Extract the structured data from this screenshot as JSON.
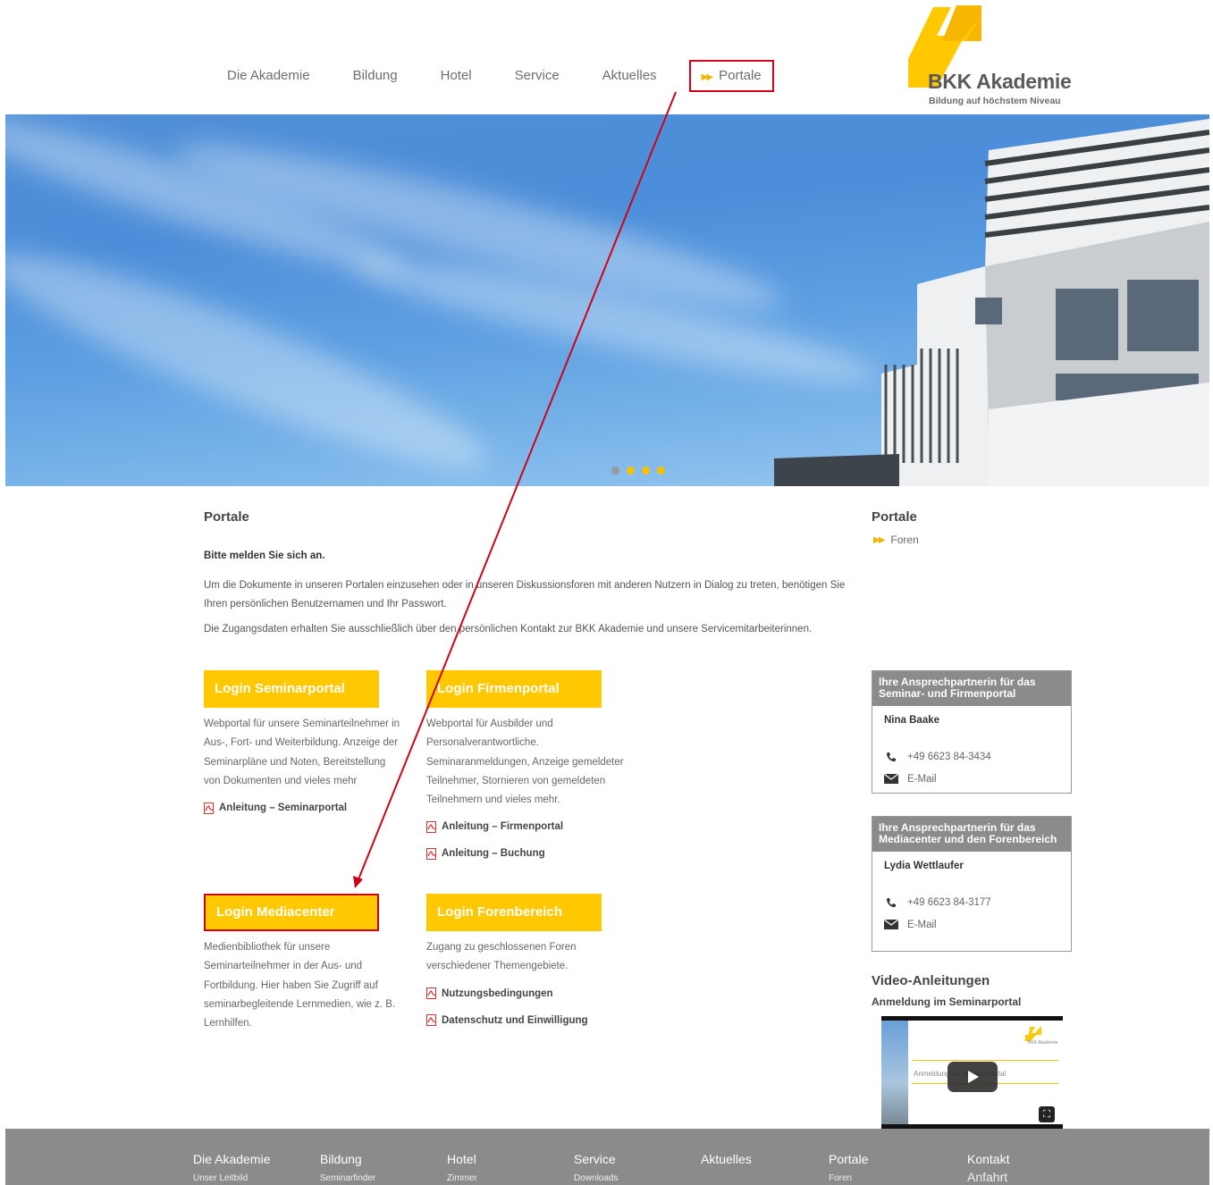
{
  "nav": {
    "items": [
      "Die Akademie",
      "Bildung",
      "Hotel",
      "Service",
      "Aktuelles"
    ],
    "active": "Portale"
  },
  "logo": {
    "name": "BKK Akademie",
    "tagline": "Bildung auf höchstem Niveau"
  },
  "hero": {
    "slide_count": 4,
    "active_slide": 1
  },
  "main": {
    "title": "Portale",
    "intro_bold": "Bitte melden Sie sich an.",
    "intro_p1": "Um die Dokumente in unseren Portalen einzusehen oder in unseren Diskussionsforen mit anderen Nutzern in Dialog zu treten, benötigen Sie Ihren persönlichen Benutzernamen und Ihr Passwort.",
    "intro_p2": "Die Zugangsdaten erhalten Sie ausschließlich über den persönlichen Kontakt zur BKK Akademie und unsere Servicemitarbeiterinnen.",
    "boxes": [
      {
        "button": "Login Seminarportal",
        "desc": "Webportal für unsere Seminarteilnehmer in Aus-, Fort- und Weiterbildung. Anzeige der Seminarpläne und Noten, Bereitstellung von Dokumenten und vieles mehr",
        "links": [
          "Anleitung – Seminarportal"
        ]
      },
      {
        "button": "Login Firmenportal",
        "desc": "Webportal für Ausbilder und Personalverantwortliche. Seminaranmeldungen, Anzeige gemeldeter Teilnehmer, Stornieren von gemeldeten Teilnehmern und vieles mehr.",
        "links": [
          "Anleitung – Firmenportal",
          "Anleitung – Buchung"
        ]
      },
      {
        "button": "Login Mediacenter",
        "desc": "Medienbibliothek für unsere Seminarteilnehmer in der Aus- und Fortbildung. Hier haben Sie Zugriff auf seminarbegleitende Lernmedien, wie z. B. Lernhilfen.",
        "links": []
      },
      {
        "button": "Login Forenbereich",
        "desc": "Zugang zu geschlossenen Foren verschiedener Themengebiete.",
        "links": [
          "Nutzungsbedingungen",
          "Datenschutz und Einwilligung"
        ]
      }
    ]
  },
  "sidebar": {
    "title": "Portale",
    "link": "Foren",
    "contacts": [
      {
        "head": "Ihre Ansprechpartnerin für das Seminar- und Firmenportal",
        "name": "Nina Baake",
        "phone": "+49 6623 84-3434",
        "email": "E-Mail"
      },
      {
        "head": "Ihre Ansprechpartnerin für das Mediacenter und den Forenbereich",
        "name": "Lydia Wettlaufer",
        "phone": "+49 6623 84-3177",
        "email": "E-Mail"
      }
    ],
    "video_title": "Video-Anleitungen",
    "video_sub": "Anmeldung im Seminarportal",
    "video_text": "Anmeldung im Seminarportal",
    "video_logo": "BKK Akademie"
  },
  "footer": {
    "cols": [
      {
        "head": "Die Akademie",
        "sub": "Unser Leitbild"
      },
      {
        "head": "Bildung",
        "sub": "Seminarfinder"
      },
      {
        "head": "Hotel",
        "sub": "Zimmer"
      },
      {
        "head": "Service",
        "sub": "Downloads"
      },
      {
        "head": "Aktuelles",
        "sub": ""
      },
      {
        "head": "Portale",
        "sub": "Foren"
      },
      {
        "head": "Kontakt",
        "sub": "Anfahrt"
      }
    ]
  },
  "colors": {
    "accent": "#ffc800",
    "highlight": "#d0021b",
    "footer": "#8b8b8b"
  }
}
